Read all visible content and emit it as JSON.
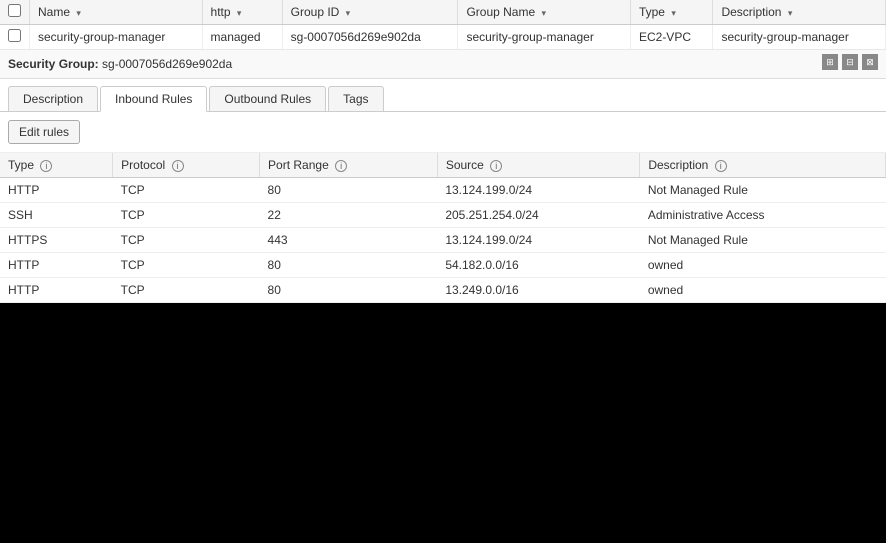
{
  "topTable": {
    "columns": [
      {
        "key": "checkbox",
        "label": ""
      },
      {
        "key": "name",
        "label": "Name",
        "sortable": true
      },
      {
        "key": "http",
        "label": "http",
        "sortable": true
      },
      {
        "key": "groupId",
        "label": "Group ID",
        "sortable": true
      },
      {
        "key": "groupName",
        "label": "Group Name",
        "sortable": true
      },
      {
        "key": "type",
        "label": "Type",
        "sortable": true
      },
      {
        "key": "description",
        "label": "Description",
        "sortable": true
      }
    ],
    "rows": [
      {
        "name": "security-group-manager",
        "http": "managed",
        "groupId": "sg-0007056d269e902da",
        "groupName": "security-group-manager",
        "type": "EC2-VPC",
        "description": "security-group-manager"
      }
    ]
  },
  "securityGroup": {
    "label": "Security Group:",
    "value": "sg-0007056d269e902da"
  },
  "tabs": [
    {
      "id": "description",
      "label": "Description",
      "active": false
    },
    {
      "id": "inbound",
      "label": "Inbound Rules",
      "active": true
    },
    {
      "id": "outbound",
      "label": "Outbound Rules",
      "active": false
    },
    {
      "id": "tags",
      "label": "Tags",
      "active": false
    }
  ],
  "editRulesButton": "Edit rules",
  "inboundRules": {
    "columns": [
      {
        "key": "type",
        "label": "Type"
      },
      {
        "key": "protocol",
        "label": "Protocol"
      },
      {
        "key": "portRange",
        "label": "Port Range"
      },
      {
        "key": "source",
        "label": "Source"
      },
      {
        "key": "description",
        "label": "Description"
      }
    ],
    "rows": [
      {
        "type": "HTTP",
        "protocol": "TCP",
        "portRange": "80",
        "source": "13.124.199.0/24",
        "description": "Not Managed Rule"
      },
      {
        "type": "SSH",
        "protocol": "TCP",
        "portRange": "22",
        "source": "205.251.254.0/24",
        "description": "Administrative Access"
      },
      {
        "type": "HTTPS",
        "protocol": "TCP",
        "portRange": "443",
        "source": "13.124.199.0/24",
        "description": "Not Managed Rule"
      },
      {
        "type": "HTTP",
        "protocol": "TCP",
        "portRange": "80",
        "source": "54.182.0.0/16",
        "description": "owned"
      },
      {
        "type": "HTTP",
        "protocol": "TCP",
        "portRange": "80",
        "source": "13.249.0.0/16",
        "description": "owned"
      }
    ]
  },
  "icons": {
    "info": "i",
    "sort": "▾",
    "grid1": "⊞",
    "grid2": "⊟",
    "grid3": "⊠"
  }
}
